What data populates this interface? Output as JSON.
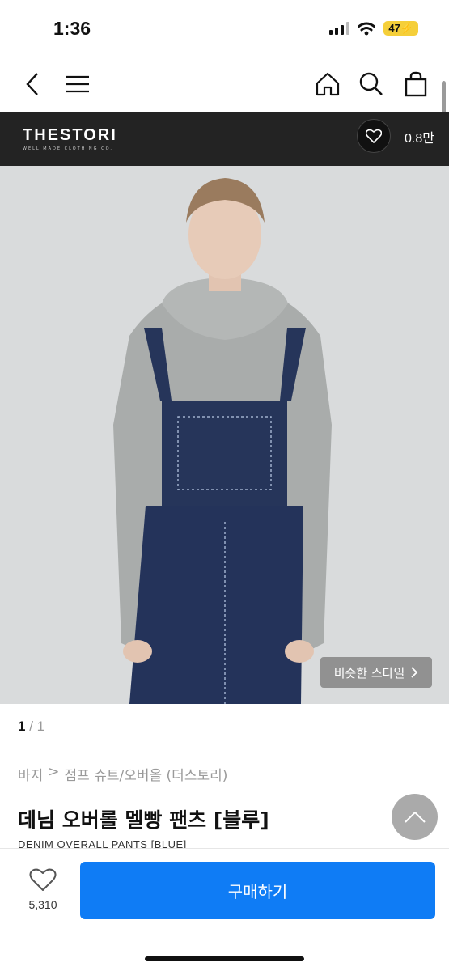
{
  "status": {
    "time": "1:36",
    "battery": "47"
  },
  "brand": {
    "name": "THESTORI",
    "tagline": "WELL MADE CLOTHING CO.",
    "likes": "0.8만"
  },
  "image": {
    "similar_label": "비슷한 스타일"
  },
  "pager": {
    "current": "1",
    "separator": " / ",
    "total": "1"
  },
  "breadcrumb": {
    "items": [
      "바지",
      ">",
      "점프 슈트/오버올 (더스토리)"
    ]
  },
  "product": {
    "title": "데님 오버롤 멜빵 팬츠 [블루]",
    "subtitle": "DENIM OVERALL PANTS [BLUE]"
  },
  "bottom": {
    "wish_count": "5,310",
    "buy_label": "구매하기"
  },
  "colors": {
    "accent": "#0f7cf5",
    "brand_bar": "#232323"
  }
}
